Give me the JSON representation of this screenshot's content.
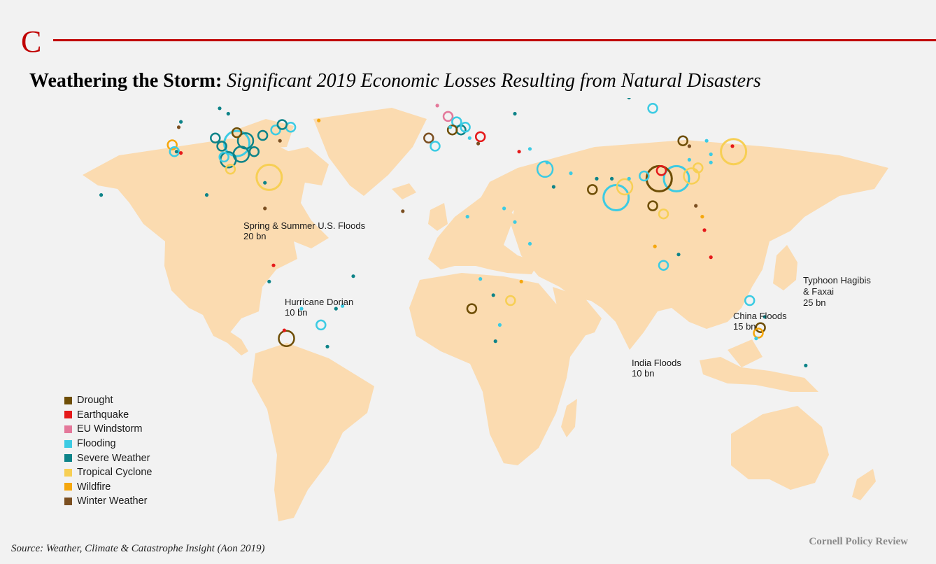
{
  "header": {
    "logo_letter": "C"
  },
  "title": {
    "main": "Weathering the Storm:",
    "subtitle": "Significant 2019 Economic Losses Resulting from Natural Disasters"
  },
  "colors": {
    "land": "#fbdbb0",
    "Drought": "#6e4e06",
    "Earthquake": "#e5191a",
    "EU Windstorm": "#e4789a",
    "Flooding": "#3ccbe3",
    "Severe Weather": "#0d8388",
    "Tropical Cyclone": "#f7cf54",
    "Wildfire": "#f5a70d",
    "Winter Weather": "#7b4f21"
  },
  "legend": [
    {
      "label": "Drought",
      "color": "#6e4e06"
    },
    {
      "label": "Earthquake",
      "color": "#e5191a"
    },
    {
      "label": "EU Windstorm",
      "color": "#e4789a"
    },
    {
      "label": "Flooding",
      "color": "#3ccbe3"
    },
    {
      "label": "Severe Weather",
      "color": "#0d8388"
    },
    {
      "label": "Tropical Cyclone",
      "color": "#f7cf54"
    },
    {
      "label": "Wildfire",
      "color": "#f5a70d"
    },
    {
      "label": "Winter Weather",
      "color": "#7b4f21"
    }
  ],
  "annotations": [
    {
      "line1": "Spring & Summer U.S. Floods",
      "line2": "20 bn"
    },
    {
      "line1": "Hurricane Dorian",
      "line2": "10 bn"
    },
    {
      "line1": "Typhoon Hagibis",
      "line2": "& Faxai",
      "line3": "25 bn"
    },
    {
      "line1": "China Floods",
      "line2": "15 bn"
    },
    {
      "line1": "India Floods",
      "line2": "10 bn"
    }
  ],
  "events": [
    {
      "type": "Flooding",
      "lon": -92,
      "lat": 39,
      "size": "large"
    },
    {
      "type": "Tropical Cyclone",
      "lon": -77,
      "lat": 26.5,
      "size": "large"
    },
    {
      "type": "Tropical Cyclone",
      "lon": 138.5,
      "lat": 36,
      "size": "large"
    },
    {
      "type": "Flooding",
      "lon": 112,
      "lat": 26,
      "size": "large"
    },
    {
      "type": "Flooding",
      "lon": 84,
      "lat": 19,
      "size": "large"
    },
    {
      "type": "Drought",
      "lon": 104,
      "lat": 26,
      "size": "large"
    },
    {
      "type": "Drought",
      "lon": -69,
      "lat": -33,
      "size": "medium"
    },
    {
      "type": "Tropical Cyclone",
      "lon": 119,
      "lat": 27,
      "size": "medium"
    },
    {
      "type": "Tropical Cyclone",
      "lon": 88,
      "lat": 23,
      "size": "medium"
    },
    {
      "type": "Flooding",
      "lon": 51,
      "lat": 29.5,
      "size": "medium"
    },
    {
      "type": "Severe Weather",
      "lon": -90,
      "lat": 35,
      "size": "medium"
    },
    {
      "type": "Severe Weather",
      "lon": -96,
      "lat": 33,
      "size": "medium"
    },
    {
      "type": "Severe Weather",
      "lon": -88,
      "lat": 40,
      "size": "medium"
    },
    {
      "type": "Severe Weather",
      "lon": -102,
      "lat": 41,
      "size": "small"
    },
    {
      "type": "Severe Weather",
      "lon": -99,
      "lat": 38,
      "size": "small"
    },
    {
      "type": "Severe Weather",
      "lon": -84,
      "lat": 36,
      "size": "small"
    },
    {
      "type": "Severe Weather",
      "lon": -80,
      "lat": 42,
      "size": "small"
    },
    {
      "type": "Flooding",
      "lon": -74,
      "lat": 44,
      "size": "small"
    },
    {
      "type": "Flooding",
      "lon": -98,
      "lat": 34,
      "size": "small"
    },
    {
      "type": "Drought",
      "lon": -92,
      "lat": 43,
      "size": "small"
    },
    {
      "type": "Earthquake",
      "lon": -118,
      "lat": 35.5,
      "size": "dot"
    },
    {
      "type": "Wildfire",
      "lon": -122,
      "lat": 38.5,
      "size": "small"
    },
    {
      "type": "Flooding",
      "lon": -121,
      "lat": 36,
      "size": "small"
    },
    {
      "type": "Severe Weather",
      "lon": -118,
      "lat": 47,
      "size": "dot"
    },
    {
      "type": "Winter Weather",
      "lon": -119,
      "lat": 45,
      "size": "dot"
    },
    {
      "type": "Severe Weather",
      "lon": -100,
      "lat": 52,
      "size": "dot"
    },
    {
      "type": "Severe Weather",
      "lon": -96,
      "lat": 50,
      "size": "dot"
    },
    {
      "type": "Severe Weather",
      "lon": -120,
      "lat": 36,
      "size": "dot"
    },
    {
      "type": "Tropical Cyclone",
      "lon": -95,
      "lat": 29.5,
      "size": "small"
    },
    {
      "type": "Severe Weather",
      "lon": -106,
      "lat": 20,
      "size": "dot"
    },
    {
      "type": "Severe Weather",
      "lon": -155,
      "lat": 20,
      "size": "dot"
    },
    {
      "type": "Winter Weather",
      "lon": -72,
      "lat": 40,
      "size": "dot"
    },
    {
      "type": "Wildfire",
      "lon": -54,
      "lat": 47.5,
      "size": "dot"
    },
    {
      "type": "Flooding",
      "lon": -67,
      "lat": 45,
      "size": "small"
    },
    {
      "type": "Severe Weather",
      "lon": -71,
      "lat": 46,
      "size": "small"
    },
    {
      "type": "Severe Weather",
      "lon": -79,
      "lat": 24.5,
      "size": "dot"
    },
    {
      "type": "Winter Weather",
      "lon": -79,
      "lat": 15,
      "size": "dot"
    },
    {
      "type": "Earthquake",
      "lon": -75,
      "lat": -6,
      "size": "dot"
    },
    {
      "type": "Severe Weather",
      "lon": -77,
      "lat": -12,
      "size": "dot"
    },
    {
      "type": "Earthquake",
      "lon": -70,
      "lat": -30,
      "size": "dot"
    },
    {
      "type": "Flooding",
      "lon": -53,
      "lat": -28,
      "size": "small"
    },
    {
      "type": "Flooding",
      "lon": -43,
      "lat": -21,
      "size": "dot"
    },
    {
      "type": "Severe Weather",
      "lon": -46,
      "lat": -22,
      "size": "dot"
    },
    {
      "type": "Severe Weather",
      "lon": -38,
      "lat": -10,
      "size": "dot"
    },
    {
      "type": "Severe Weather",
      "lon": -50,
      "lat": -36,
      "size": "dot"
    },
    {
      "type": "Flooding",
      "lon": -62,
      "lat": -22,
      "size": "dot"
    },
    {
      "type": "Winter Weather",
      "lon": -3,
      "lat": 41,
      "size": "small"
    },
    {
      "type": "Flooding",
      "lon": 0,
      "lat": 38,
      "size": "small"
    },
    {
      "type": "EU Windstorm",
      "lon": 6,
      "lat": 49,
      "size": "small"
    },
    {
      "type": "EU Windstorm",
      "lon": 1,
      "lat": 53,
      "size": "dot"
    },
    {
      "type": "EU Windstorm",
      "lon": 17,
      "lat": 60,
      "size": "dot"
    },
    {
      "type": "Flooding",
      "lon": 10,
      "lat": 47,
      "size": "small"
    },
    {
      "type": "Severe Weather",
      "lon": 12,
      "lat": 44,
      "size": "small"
    },
    {
      "type": "Flooding",
      "lon": 14,
      "lat": 45,
      "size": "small"
    },
    {
      "type": "Earthquake",
      "lon": 21,
      "lat": 41.5,
      "size": "small"
    },
    {
      "type": "Flooding",
      "lon": 7,
      "lat": 45,
      "size": "dot"
    },
    {
      "type": "Drought",
      "lon": 8,
      "lat": 44,
      "size": "small"
    },
    {
      "type": "Winter Weather",
      "lon": 20,
      "lat": 39,
      "size": "dot"
    },
    {
      "type": "Flooding",
      "lon": 16,
      "lat": 41,
      "size": "dot"
    },
    {
      "type": "Flooding",
      "lon": 44,
      "lat": 37,
      "size": "dot"
    },
    {
      "type": "Earthquake",
      "lon": 39,
      "lat": 36,
      "size": "dot"
    },
    {
      "type": "Flooding",
      "lon": 52,
      "lat": 32,
      "size": "dot"
    },
    {
      "type": "Severe Weather",
      "lon": 55,
      "lat": 23,
      "size": "dot"
    },
    {
      "type": "Drought",
      "lon": 73,
      "lat": 22,
      "size": "small"
    },
    {
      "type": "Severe Weather",
      "lon": 75,
      "lat": 26,
      "size": "dot"
    },
    {
      "type": "Flooding",
      "lon": 63,
      "lat": 28,
      "size": "dot"
    },
    {
      "type": "Flooding",
      "lon": 90,
      "lat": 26,
      "size": "dot"
    },
    {
      "type": "Severe Weather",
      "lon": 82,
      "lat": 26,
      "size": "dot"
    },
    {
      "type": "Flooding",
      "lon": 97,
      "lat": 27,
      "size": "small"
    },
    {
      "type": "Earthquake",
      "lon": 105,
      "lat": 29,
      "size": "small"
    },
    {
      "type": "Flooding",
      "lon": 118,
      "lat": 33,
      "size": "dot"
    },
    {
      "type": "Drought",
      "lon": 115,
      "lat": 40,
      "size": "small"
    },
    {
      "type": "Flooding",
      "lon": 126,
      "lat": 40,
      "size": "dot"
    },
    {
      "type": "Winter Weather",
      "lon": 118,
      "lat": 38,
      "size": "dot"
    },
    {
      "type": "Tropical Cyclone",
      "lon": 122,
      "lat": 30,
      "size": "small"
    },
    {
      "type": "Flooding",
      "lon": 128,
      "lat": 35,
      "size": "dot"
    },
    {
      "type": "Earthquake",
      "lon": 138,
      "lat": 38,
      "size": "dot"
    },
    {
      "type": "Flooding",
      "lon": 128,
      "lat": 32,
      "size": "dot"
    },
    {
      "type": "Drought",
      "lon": 101,
      "lat": 16,
      "size": "small"
    },
    {
      "type": "Tropical Cyclone",
      "lon": 106,
      "lat": 13,
      "size": "small"
    },
    {
      "type": "Winter Weather",
      "lon": 121,
      "lat": 16,
      "size": "dot"
    },
    {
      "type": "Wildfire",
      "lon": 124,
      "lat": 12,
      "size": "dot"
    },
    {
      "type": "Earthquake",
      "lon": 125,
      "lat": 7,
      "size": "dot"
    },
    {
      "type": "Flooding",
      "lon": 106,
      "lat": -6,
      "size": "small"
    },
    {
      "type": "Earthquake",
      "lon": 128,
      "lat": -3,
      "size": "dot"
    },
    {
      "type": "Severe Weather",
      "lon": 113,
      "lat": -2,
      "size": "dot"
    },
    {
      "type": "Wildfire",
      "lon": 102,
      "lat": 1,
      "size": "dot"
    },
    {
      "type": "Severe Weather",
      "lon": 90,
      "lat": 56,
      "size": "dot"
    },
    {
      "type": "Flooding",
      "lon": 101,
      "lat": 52,
      "size": "small"
    },
    {
      "type": "Wildfire",
      "lon": 95,
      "lat": 59,
      "size": "dot"
    },
    {
      "type": "Severe Weather",
      "lon": 37,
      "lat": 50,
      "size": "dot"
    },
    {
      "type": "Winter Weather",
      "lon": -15,
      "lat": 14,
      "size": "dot"
    },
    {
      "type": "Flooding",
      "lon": 32,
      "lat": 15,
      "size": "dot"
    },
    {
      "type": "Flooding",
      "lon": 37,
      "lat": 10,
      "size": "dot"
    },
    {
      "type": "Flooding",
      "lon": 44,
      "lat": 2,
      "size": "dot"
    },
    {
      "type": "Flooding",
      "lon": 15,
      "lat": 12,
      "size": "dot"
    },
    {
      "type": "Drought",
      "lon": 17,
      "lat": -22,
      "size": "small"
    },
    {
      "type": "Tropical Cyclone",
      "lon": 35,
      "lat": -19,
      "size": "small"
    },
    {
      "type": "Wildfire",
      "lon": 40,
      "lat": -12,
      "size": "dot"
    },
    {
      "type": "Severe Weather",
      "lon": 28,
      "lat": -34,
      "size": "dot"
    },
    {
      "type": "Flooding",
      "lon": 30,
      "lat": -28,
      "size": "dot"
    },
    {
      "type": "Severe Weather",
      "lon": 27,
      "lat": -17,
      "size": "dot"
    },
    {
      "type": "Flooding",
      "lon": 21,
      "lat": -11,
      "size": "dot"
    },
    {
      "type": "Flooding",
      "lon": 146,
      "lat": -19,
      "size": "small"
    },
    {
      "type": "Drought",
      "lon": 151,
      "lat": -29,
      "size": "small"
    },
    {
      "type": "Wildfire",
      "lon": 150,
      "lat": -31,
      "size": "small"
    },
    {
      "type": "Severe Weather",
      "lon": 153,
      "lat": -25,
      "size": "dot"
    },
    {
      "type": "Flooding",
      "lon": 149,
      "lat": -33,
      "size": "dot"
    },
    {
      "type": "Severe Weather",
      "lon": 172,
      "lat": -43,
      "size": "dot"
    }
  ],
  "footer": {
    "source": "Source: Weather, Climate & Catastrophe Insight (Aon 2019)",
    "brand": "Cornell Policy Review"
  }
}
